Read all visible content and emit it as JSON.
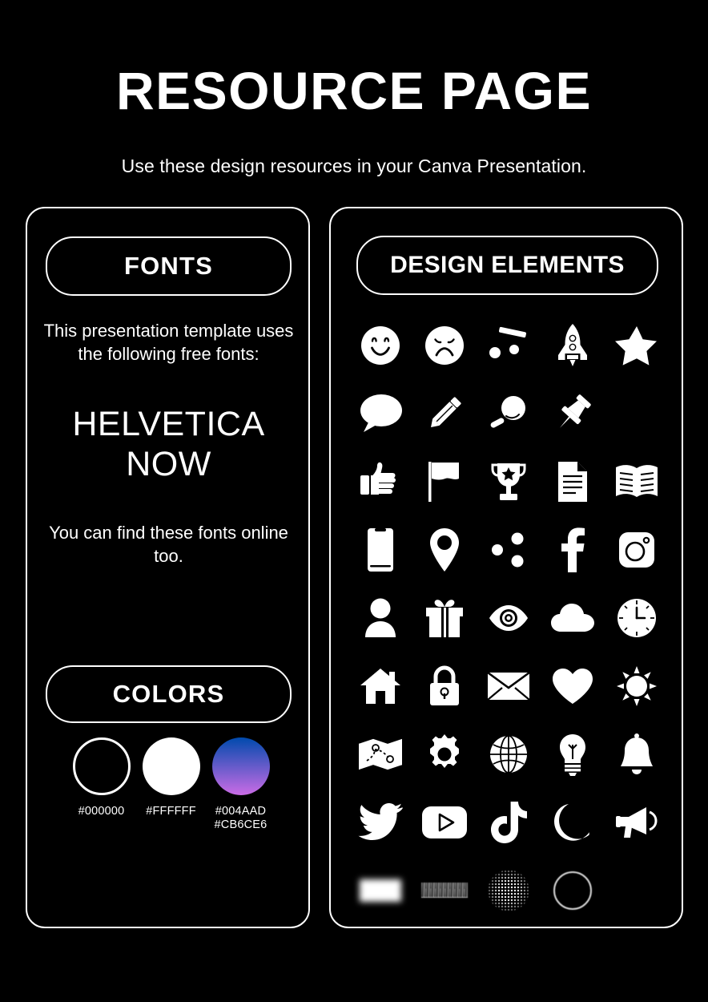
{
  "header": {
    "title": "RESOURCE PAGE",
    "subtitle": "Use these design resources in your Canva Presentation."
  },
  "fonts_panel": {
    "heading": "FONTS",
    "intro": "This presentation template uses the following free fonts:",
    "font_name": "HELVETICA NOW",
    "note": "You can find these fonts online too."
  },
  "colors_panel": {
    "heading": "COLORS",
    "swatches": [
      {
        "name": "black-swatch",
        "label": "#000000",
        "hex": "#000000"
      },
      {
        "name": "white-swatch",
        "label": "#FFFFFF",
        "hex": "#FFFFFF"
      },
      {
        "name": "gradient-swatch",
        "label": "#004AAD\n#CB6CE6",
        "hex_from": "#004AAD",
        "hex_to": "#CB6CE6"
      }
    ]
  },
  "design_panel": {
    "heading": "DESIGN ELEMENTS",
    "icon_rows": [
      [
        "smiley-face-icon",
        "sad-face-icon",
        "confetti-icon",
        "rocket-icon",
        "star-icon"
      ],
      [
        "speech-bubble-icon",
        "pencil-icon",
        "magnifying-glass-icon",
        "pushpin-icon"
      ],
      [
        "thumbs-up-icon",
        "flag-icon",
        "trophy-icon",
        "document-icon",
        "open-book-icon"
      ],
      [
        "mobile-phone-icon",
        "location-pin-icon",
        "share-dots-icon",
        "facebook-icon",
        "instagram-icon"
      ],
      [
        "user-person-icon",
        "gift-box-icon",
        "eye-icon",
        "cloud-icon",
        "clock-icon"
      ],
      [
        "home-house-icon",
        "padlock-icon",
        "envelope-icon",
        "heart-icon",
        "sun-icon"
      ],
      [
        "map-icon",
        "gear-icon",
        "globe-icon",
        "lightbulb-icon",
        "bell-icon"
      ],
      [
        "twitter-icon",
        "youtube-icon",
        "tiktok-icon",
        "moon-icon",
        "megaphone-icon"
      ],
      [
        "blurred-rectangle-texture",
        "film-strip-texture",
        "halftone-dot-circle-texture",
        "circle-outline-texture"
      ]
    ]
  },
  "theme": {
    "background": "#000000",
    "foreground": "#FFFFFF"
  }
}
